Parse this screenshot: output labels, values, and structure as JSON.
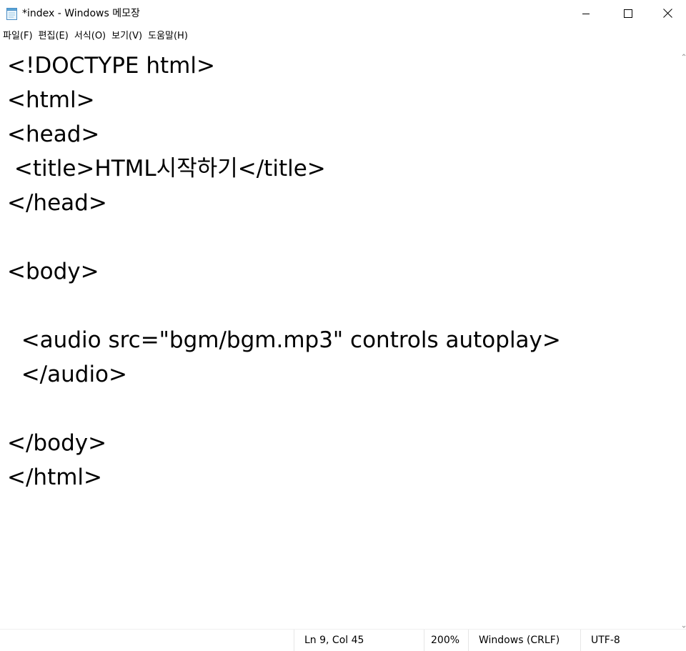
{
  "window": {
    "title": "*index - Windows 메모장",
    "controls": {
      "minimize": "minimize-icon",
      "maximize": "maximize-icon",
      "close": "close-icon"
    }
  },
  "menu": {
    "items": [
      "파일(F)",
      "편집(E)",
      "서식(O)",
      "보기(V)",
      "도움말(H)"
    ]
  },
  "editor": {
    "lines": [
      "<!DOCTYPE html>",
      "<html>",
      "<head>",
      " <title>HTML시작하기</title>",
      "</head>",
      "",
      "<body>",
      "",
      "  <audio src=\"bgm/bgm.mp3\" controls autoplay>",
      "  </audio>",
      "",
      "</body>",
      "</html>"
    ]
  },
  "status": {
    "position": "Ln 9, Col 45",
    "zoom": "200%",
    "line_ending": "Windows (CRLF)",
    "encoding": "UTF-8"
  },
  "colors": {
    "background": "#ffffff",
    "text": "#000000",
    "icon_blue": "#5aa6d8"
  }
}
